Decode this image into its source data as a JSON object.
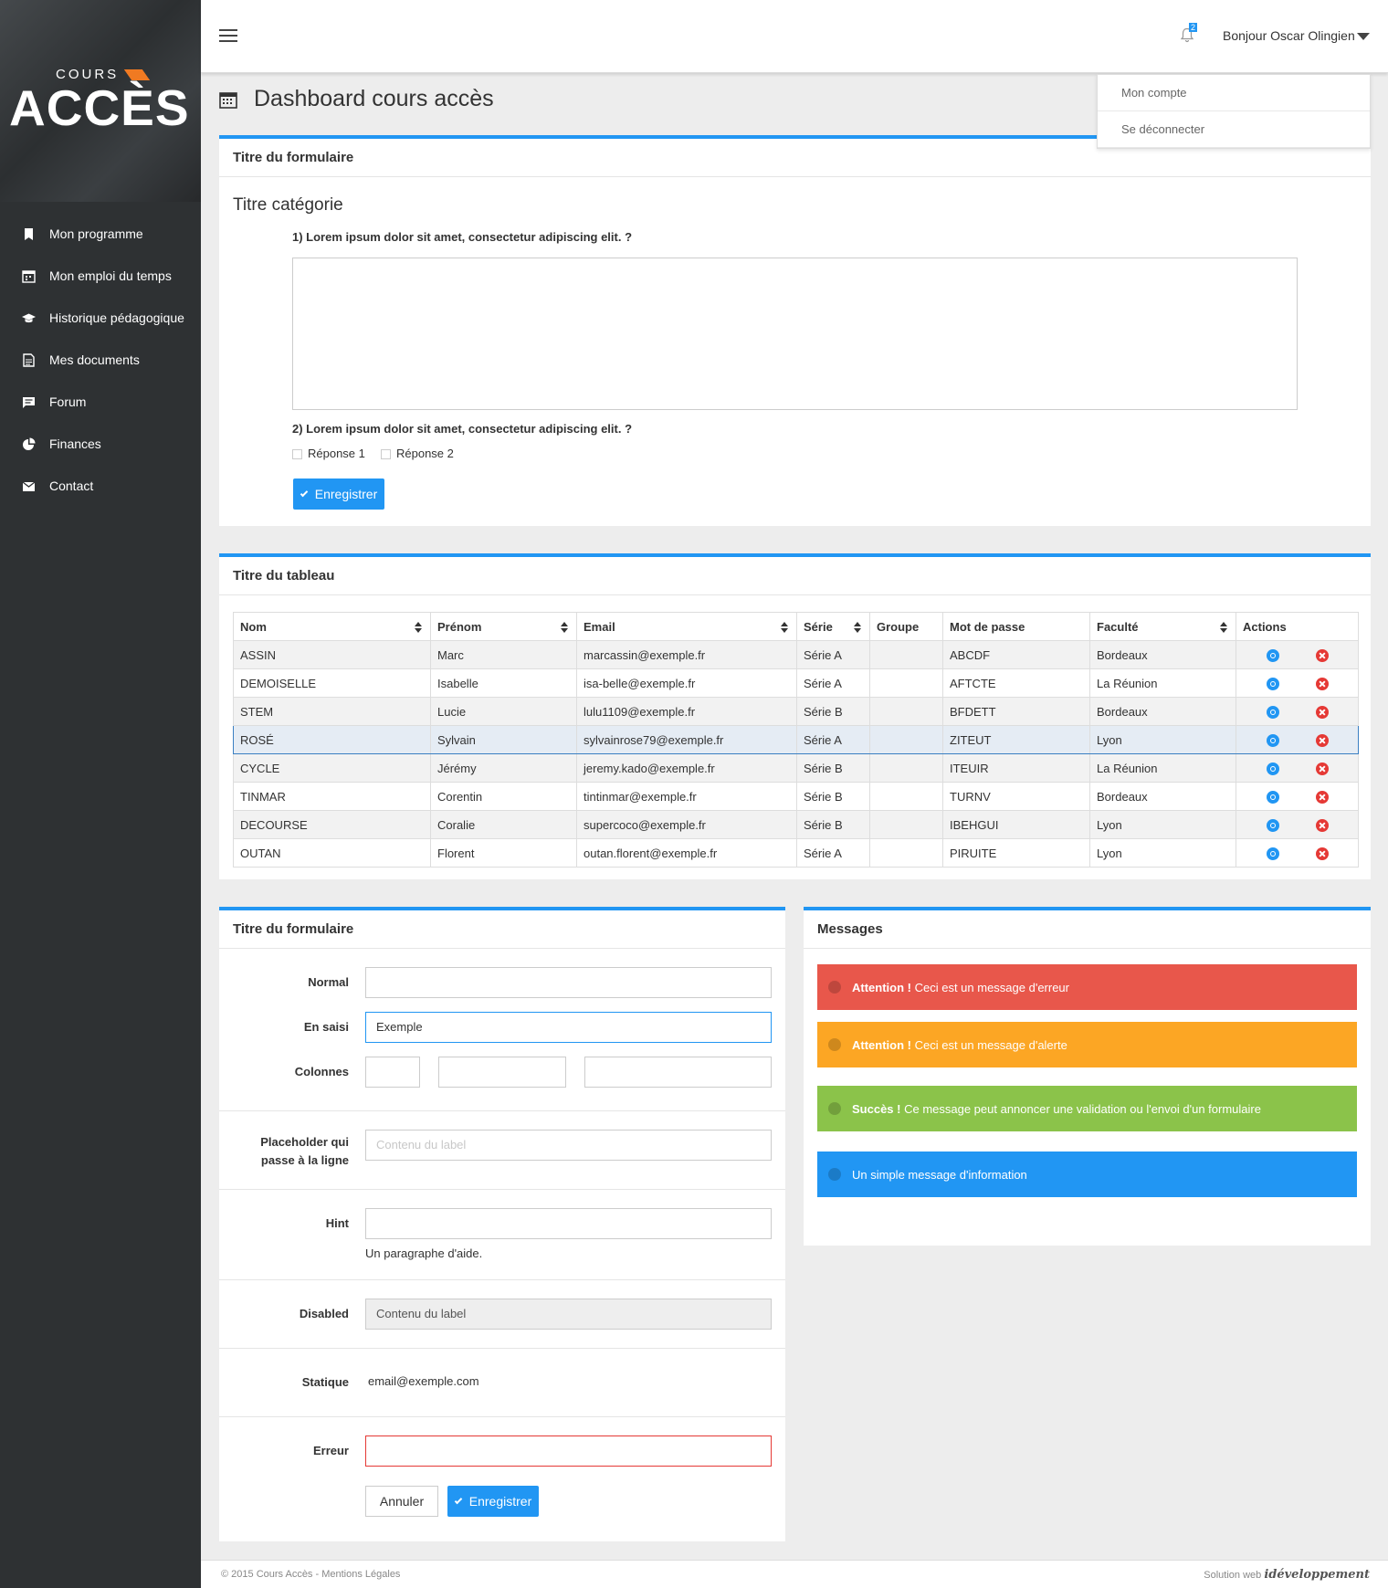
{
  "brand": {
    "top": "COURS",
    "main": "ACCÈS"
  },
  "sidebar": {
    "items": [
      {
        "label": "Mon programme",
        "icon": "bookmark-icon"
      },
      {
        "label": "Mon emploi du temps",
        "icon": "calendar-icon"
      },
      {
        "label": "Historique pédagogique",
        "icon": "graduation-cap-icon"
      },
      {
        "label": "Mes documents",
        "icon": "document-icon"
      },
      {
        "label": "Forum",
        "icon": "chat-icon"
      },
      {
        "label": "Finances",
        "icon": "pie-chart-icon"
      },
      {
        "label": "Contact",
        "icon": "envelope-icon"
      }
    ]
  },
  "topbar": {
    "notifications": "2",
    "greeting": "Bonjour Oscar Olingien"
  },
  "user_menu": {
    "account": "Mon compte",
    "logout": "Se déconnecter"
  },
  "page": {
    "title": "Dashboard cours accès"
  },
  "form1": {
    "title": "Titre du formulaire",
    "category": "Titre catégorie",
    "q1": "1) Lorem ipsum dolor sit amet, consectetur adipiscing elit. ?",
    "q2": "2) Lorem ipsum dolor sit amet, consectetur adipiscing elit. ?",
    "answer1": "Réponse 1",
    "answer2": "Réponse 2",
    "save": "Enregistrer"
  },
  "table": {
    "title": "Titre du tableau",
    "headers": [
      "Nom",
      "Prénom",
      "Email",
      "Série",
      "Groupe",
      "Mot de passe",
      "Faculté",
      "Actions"
    ],
    "rows": [
      [
        "ASSIN",
        "Marc",
        "marcassin@exemple.fr",
        "Série A",
        "",
        "ABCDF",
        "Bordeaux"
      ],
      [
        "DEMOISELLE",
        "Isabelle",
        "isa-belle@exemple.fr",
        "Série A",
        "",
        "AFTCTE",
        "La Réunion"
      ],
      [
        "STEM",
        "Lucie",
        "lulu1109@exemple.fr",
        "Série B",
        "",
        "BFDETT",
        "Bordeaux"
      ],
      [
        "ROSÉ",
        "Sylvain",
        "sylvainrose79@exemple.fr",
        "Série A",
        "",
        "ZITEUT",
        "Lyon"
      ],
      [
        "CYCLE",
        "Jérémy",
        "jeremy.kado@exemple.fr",
        "Série B",
        "",
        "ITEUIR",
        "La Réunion"
      ],
      [
        "TINMAR",
        "Corentin",
        "tintinmar@exemple.fr",
        "Série B",
        "",
        "TURNV",
        "Bordeaux"
      ],
      [
        "DECOURSE",
        "Coralie",
        "supercoco@exemple.fr",
        "Série B",
        "",
        "IBEHGUI",
        "Lyon"
      ],
      [
        "OUTAN",
        "Florent",
        "outan.florent@exemple.fr",
        "Série A",
        "",
        "PIRUITE",
        "Lyon"
      ]
    ]
  },
  "form2": {
    "title": "Titre du formulaire",
    "normal_label": "Normal",
    "typing_label": "En saisi",
    "typing_value": "Exemple",
    "columns_label": "Colonnes",
    "placeholder_label_1": "Placeholder qui",
    "placeholder_label_2": "passe à la ligne",
    "placeholder_text": "Contenu du label",
    "hint_label": "Hint",
    "hint_text": "Un paragraphe d'aide.",
    "disabled_label": "Disabled",
    "disabled_value": "Contenu du label",
    "static_label": "Statique",
    "static_value": "email@exemple.com",
    "error_label": "Erreur",
    "cancel": "Annuler",
    "save": "Enregistrer"
  },
  "messages": {
    "title": "Messages",
    "error_strong": "Attention !",
    "error_text": " Ceci est un message d'erreur",
    "warning_strong": "Attention !",
    "warning_text": " Ceci est un message d'alerte",
    "success_strong": "Succès !",
    "success_text": " Ce message peut annoncer une validation ou l'envoi d'un formulaire",
    "info_text": "Un simple message d'information",
    "colors": {
      "error": "#e8574b",
      "warning": "#fca624",
      "success": "#8bc34a",
      "info": "#2196f3"
    }
  },
  "footer": {
    "left": "© 2015 Cours Accès - Mentions Légales",
    "right_prefix": "Solution web ",
    "right_brand": "idéveloppement"
  }
}
